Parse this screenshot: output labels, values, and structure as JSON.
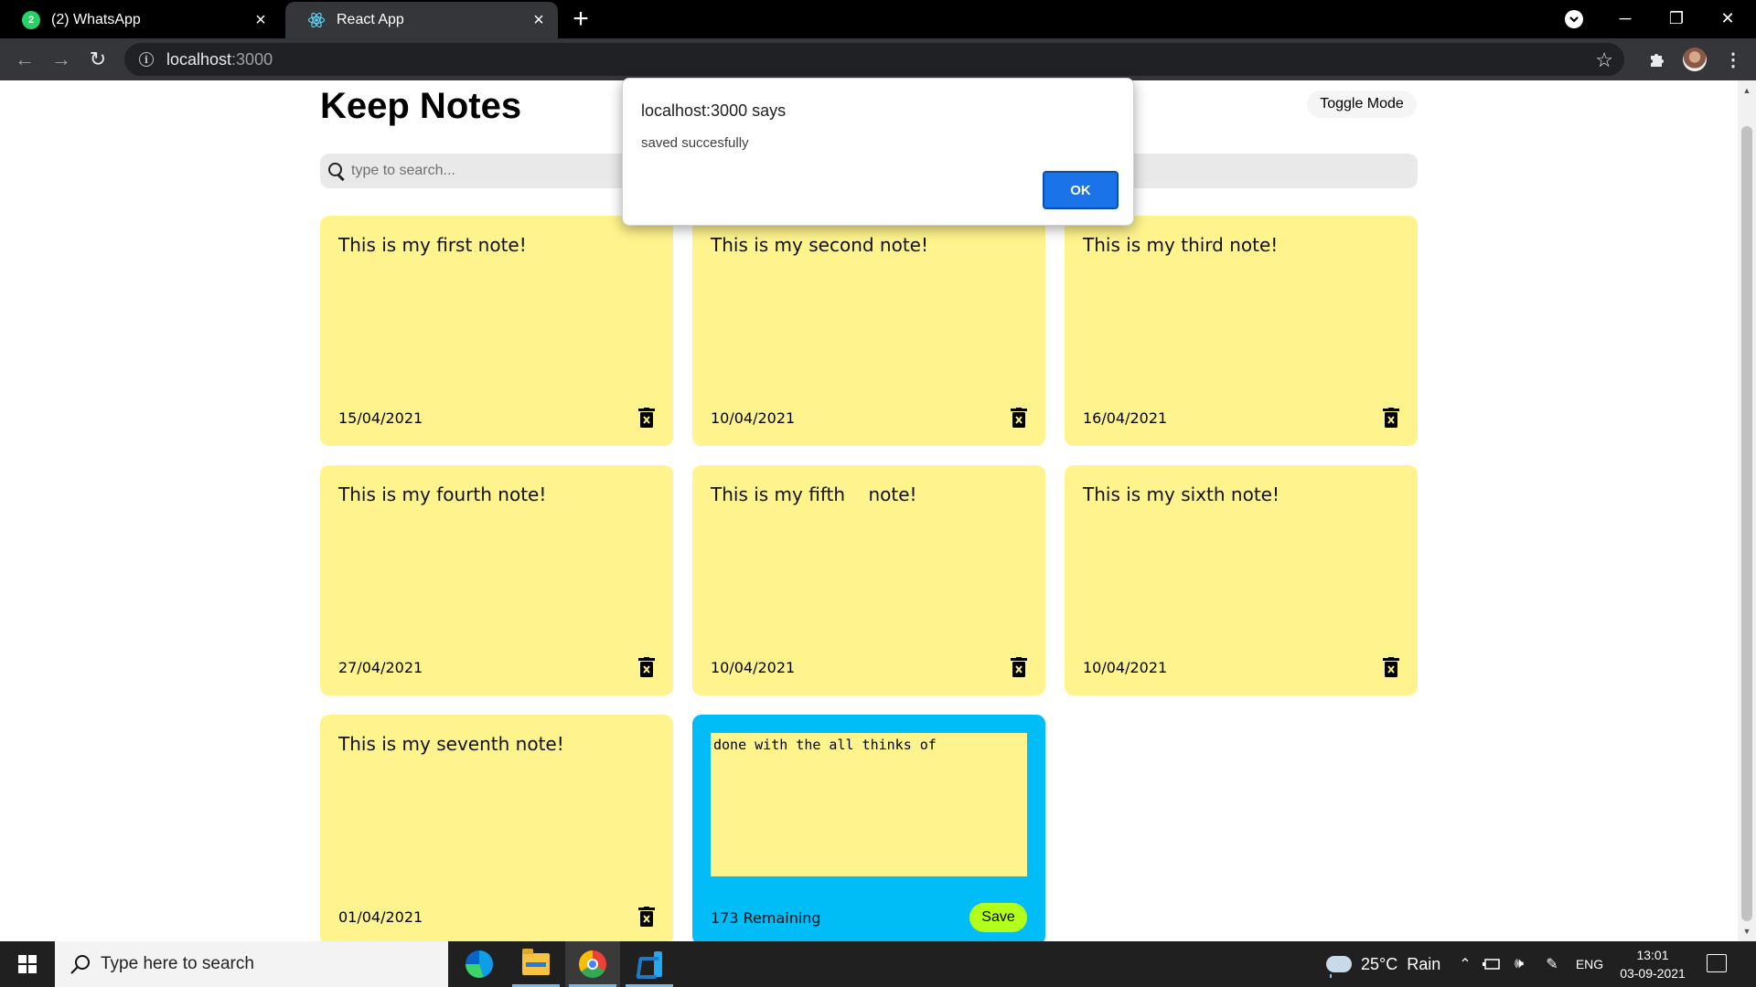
{
  "browser": {
    "tabs": [
      {
        "title": "(2) WhatsApp",
        "badge": "2",
        "active": false
      },
      {
        "title": "React App",
        "active": true
      }
    ],
    "address": {
      "host": "localhost",
      "port": ":3000"
    }
  },
  "app": {
    "title": "Keep Notes",
    "toggle_label": "Toggle Mode",
    "search_placeholder": "type to search...",
    "notes": [
      {
        "text": "This is my first note!",
        "date": "15/04/2021"
      },
      {
        "text": "This is my second note!",
        "date": "10/04/2021"
      },
      {
        "text": "This is my third note!",
        "date": "16/04/2021"
      },
      {
        "text": "This is my fourth note!",
        "date": "27/04/2021"
      },
      {
        "text": "This is my fifth    note!",
        "date": "10/04/2021"
      },
      {
        "text": "This is my sixth note!",
        "date": "10/04/2021"
      },
      {
        "text": "This is my seventh note!",
        "date": "01/04/2021"
      }
    ],
    "new_note": {
      "text": "done with the all thinks of",
      "remaining": "173 Remaining",
      "save_label": "Save"
    },
    "colors": {
      "note": "#fef38c",
      "new_note": "#00bcf7",
      "save": "#b3ff1c"
    }
  },
  "dialog": {
    "title": "localhost:3000 says",
    "message": "saved succesfully",
    "ok_label": "OK"
  },
  "taskbar": {
    "search_placeholder": "Type here to search",
    "weather": "25°C  Rain",
    "language": "ENG",
    "time": "13:01",
    "date": "03-09-2021"
  }
}
